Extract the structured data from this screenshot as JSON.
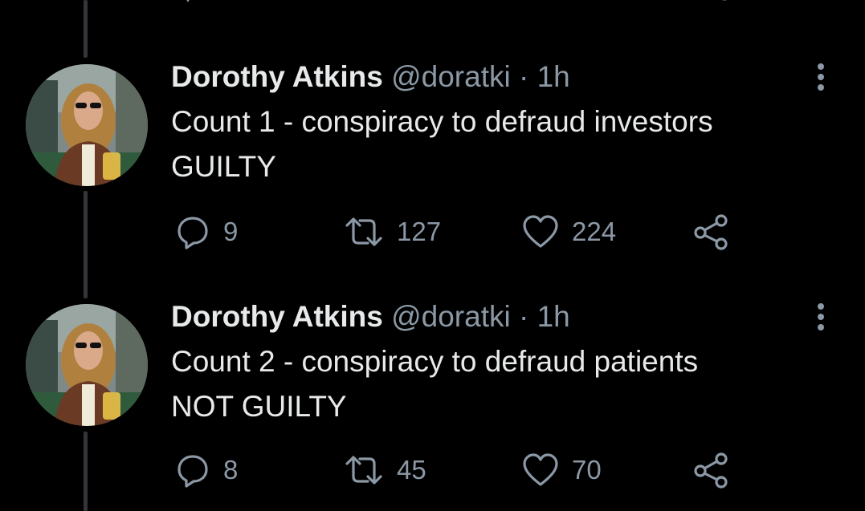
{
  "tweets": [
    {
      "display_name": "Dorothy Atkins",
      "handle": "@doratki",
      "separator": "·",
      "time": "1h",
      "text_line1": "Count 1 - conspiracy to defraud investors",
      "text_line2": "GUILTY",
      "replies": "9",
      "retweets": "127",
      "likes": "224"
    },
    {
      "display_name": "Dorothy Atkins",
      "handle": "@doratki",
      "separator": "·",
      "time": "1h",
      "text_line1": "Count 2 - conspiracy to defraud patients",
      "text_line2": "NOT GUILTY",
      "replies": "8",
      "retweets": "45",
      "likes": "70"
    }
  ],
  "icons": {
    "reply": "reply-icon",
    "retweet": "retweet-icon",
    "like": "heart-icon",
    "share": "share-icon",
    "more": "more-vertical-icon"
  },
  "colors": {
    "background": "#000000",
    "primary_text": "#e7e9ea",
    "secondary_text": "#8b98a5",
    "thread_line": "#333639"
  }
}
